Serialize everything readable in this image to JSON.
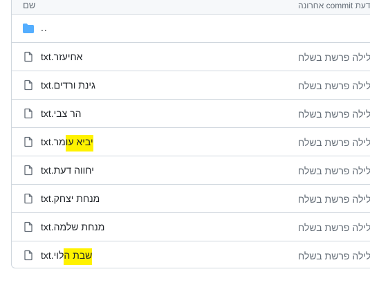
{
  "header": {
    "name_col": "שם",
    "commit_col": "הודעת commit אחרונה"
  },
  "parent_dir": {
    "label": "..",
    "icon": "folder-icon"
  },
  "files": [
    {
      "pre": "txt.",
      "hl": "",
      "post": "אחיעזר",
      "commit": "לילה פרשת בשלח"
    },
    {
      "pre": "txt.",
      "hl": "",
      "post": "גינת ורדים",
      "commit": "לילה פרשת בשלח"
    },
    {
      "pre": "txt.",
      "hl": "",
      "post": "הר צבי",
      "commit": "לילה פרשת בשלח"
    },
    {
      "pre": "txt.",
      "hl": "יביא עו",
      "post": "מר",
      "commit": "לילה פרשת בשלח"
    },
    {
      "pre": "txt.",
      "hl": "",
      "post": "יחווה דעת",
      "commit": "לילה פרשת בשלח"
    },
    {
      "pre": "txt.",
      "hl": "",
      "post": "מנחת יצחק",
      "commit": "לילה פרשת בשלח"
    },
    {
      "pre": "txt.",
      "hl": "",
      "post": "מנחת שלמה",
      "commit": "לילה פרשת בשלח"
    },
    {
      "pre": "txt.",
      "hl": "שבת ה",
      "post": "לוי",
      "commit": "לילה פרשת בשלח"
    }
  ],
  "colors": {
    "folder": "#54aeff",
    "file_icon": "#636c76",
    "highlight": "#fff200",
    "border": "#d0d7de"
  }
}
